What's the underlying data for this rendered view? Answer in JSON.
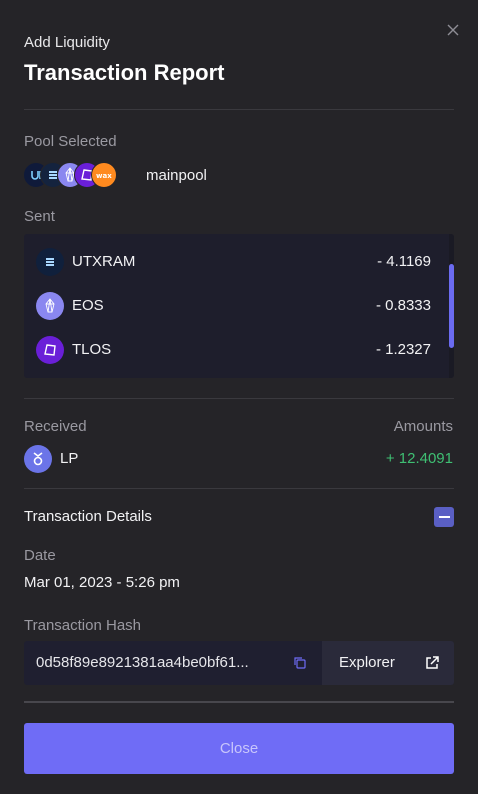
{
  "header": {
    "subtitle": "Add Liquidity",
    "title": "Transaction Report"
  },
  "pool": {
    "label": "Pool Selected",
    "name": "mainpool",
    "icons": [
      "utx-icon",
      "utxram-icon",
      "eos-icon",
      "tlos-icon",
      "wax-icon"
    ]
  },
  "sent": {
    "label": "Sent",
    "rows": [
      {
        "token": "UTXRAM",
        "amount": "- 4.1169",
        "icon": "utxram-icon"
      },
      {
        "token": "EOS",
        "amount": "- 0.8333",
        "icon": "eos-icon"
      },
      {
        "token": "TLOS",
        "amount": "- 1.2327",
        "icon": "tlos-icon"
      }
    ]
  },
  "received": {
    "label": "Received",
    "amounts_label": "Amounts",
    "token": "LP",
    "amount": "+ 12.4091",
    "icon": "lp-icon"
  },
  "details": {
    "title": "Transaction Details",
    "date_label": "Date",
    "date_value": "Mar 01, 2023 - 5:26 pm",
    "hash_label": "Transaction Hash",
    "hash_value": "0d58f89e8921381aa4be0bf61...",
    "explorer_label": "Explorer"
  },
  "footer": {
    "close_label": "Close"
  },
  "colors": {
    "background": "#252428",
    "accent": "#6f6cf6",
    "positive": "#3fbf73",
    "muted_text": "#9a99a1"
  }
}
